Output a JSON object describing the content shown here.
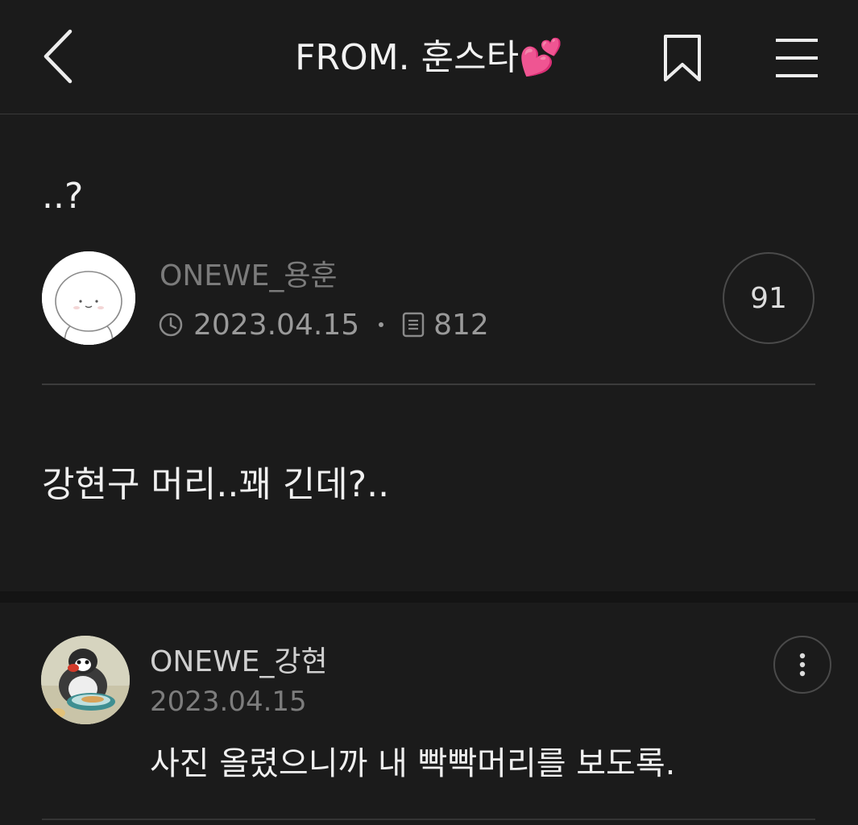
{
  "header": {
    "title": "FROM. 훈스타💕",
    "back_icon": "chevron-left-icon",
    "bookmark_icon": "bookmark-icon",
    "menu_icon": "hamburger-menu-icon"
  },
  "post": {
    "title": "..?",
    "author": "ONEWE_용훈",
    "date": "2023.04.15",
    "views": "812",
    "comment_count": "91",
    "body": "강현구 머리..꽤 긴데?.."
  },
  "comment": {
    "author": "ONEWE_강현",
    "date": "2023.04.15",
    "text": "사진 올렸으니까 내 빡빡머리를 보도록.",
    "more_icon": "more-vertical-icon"
  },
  "colors": {
    "background": "#1b1b1b",
    "text_primary": "#f0f0f0",
    "text_muted": "#7b7b7b",
    "divider": "#3c3c3c"
  }
}
